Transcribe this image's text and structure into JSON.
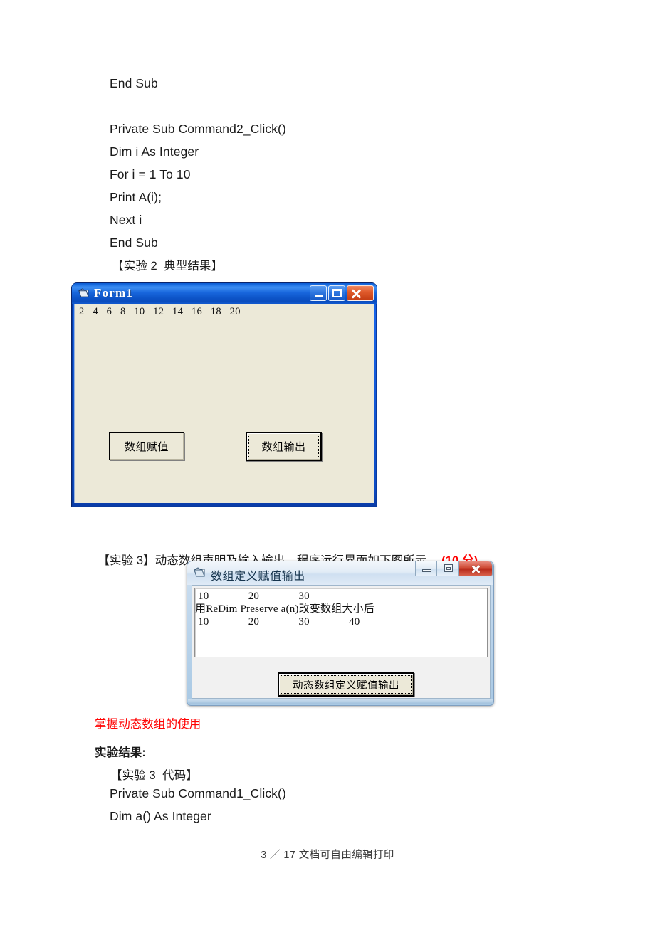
{
  "document": {
    "code_block_1": [
      "End Sub",
      "",
      "Private Sub Command2_Click()",
      "Dim i As Integer",
      "For i = 1 To 10",
      "Print A(i);",
      "Next i",
      "End Sub"
    ],
    "caption_experiment2": "【实验 2  典型结果】",
    "experiment3_heading": "【实验 3】动态数组声明及输入输出，程序运行界面如下图所示。",
    "experiment3_score": "(10 分)",
    "objective_note": "掌握动态数组的使用",
    "result_heading": "实验结果:",
    "caption_experiment3_code": "【实验 3  代码】",
    "code_block_2": [
      "Private Sub Command1_Click()",
      "Dim a() As Integer"
    ],
    "footer": "3 ／ 17 文档可自由编辑打印"
  },
  "xp_form": {
    "title": "Form1",
    "icon": "vb-form-icon",
    "output_text": "2   4   6   8   10   12   14   16   18   20",
    "minimize_label": "最小化",
    "maximize_label": "最大化",
    "close_label": "关闭",
    "buttons": [
      {
        "label": "数组赋值",
        "focused": false
      },
      {
        "label": "数组输出",
        "focused": true
      }
    ],
    "colors": {
      "titlebar": "#1866dc",
      "client": "#ece9d8",
      "close": "#c33c12"
    }
  },
  "win7_form": {
    "title": "数组定义赋值输出",
    "icon": "vb-form-icon",
    "output_lines": [
      "10              20              30",
      "用ReDim Preserve a(n)改变数组大小后",
      "10              20              30              40"
    ],
    "minimize_label": "最小化",
    "maximize_label": "最大化",
    "close_label": "关闭",
    "button": {
      "label": "动态数组定义赋值输出",
      "focused": true
    },
    "colors": {
      "frame": "#bed6ec",
      "client": "#f1f1f1",
      "close": "#b62718"
    }
  }
}
